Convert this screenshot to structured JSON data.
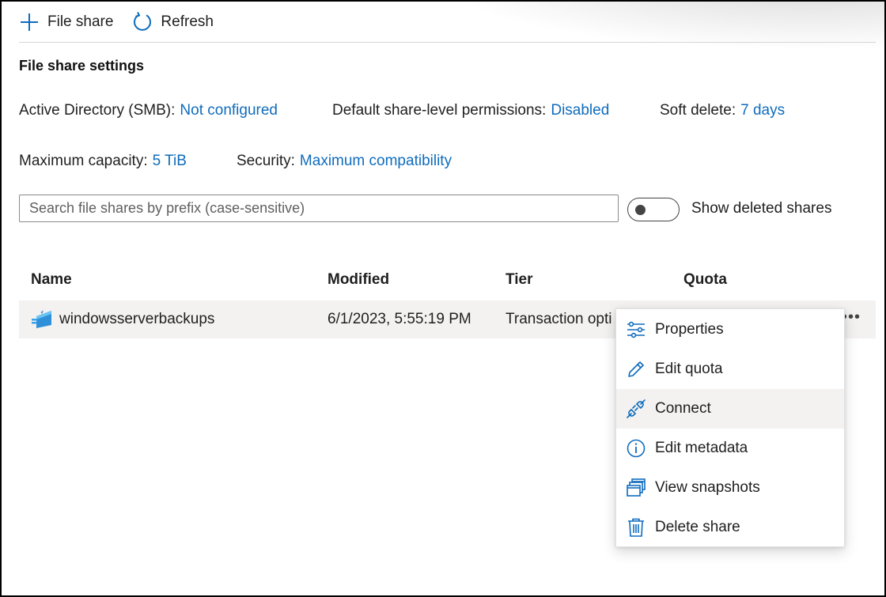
{
  "toolbar": {
    "add_label": "File share",
    "refresh_label": "Refresh"
  },
  "settings": {
    "title": "File share settings",
    "active_directory": {
      "label": "Active Directory (SMB):",
      "value": "Not configured"
    },
    "default_permissions": {
      "label": "Default share-level permissions:",
      "value": "Disabled"
    },
    "soft_delete": {
      "label": "Soft delete:",
      "value": "7 days"
    },
    "max_capacity": {
      "label": "Maximum capacity:",
      "value": "5 TiB"
    },
    "security": {
      "label": "Security:",
      "value": "Maximum compatibility"
    }
  },
  "search": {
    "placeholder": "Search file shares by prefix (case-sensitive)",
    "value": ""
  },
  "show_deleted": {
    "label": "Show deleted shares",
    "on": false
  },
  "table": {
    "columns": [
      "Name",
      "Modified",
      "Tier",
      "Quota"
    ],
    "rows": [
      {
        "name": "windowsserverbackups",
        "modified": "6/1/2023, 5:55:19 PM",
        "tier": "Transaction opti"
      }
    ],
    "more_label": "•••"
  },
  "context_menu": {
    "items": [
      {
        "label": "Properties",
        "icon": "properties-icon"
      },
      {
        "label": "Edit quota",
        "icon": "pencil-icon"
      },
      {
        "label": "Connect",
        "icon": "plug-icon",
        "highlighted": true
      },
      {
        "label": "Edit metadata",
        "icon": "info-icon"
      },
      {
        "label": "View snapshots",
        "icon": "snapshots-icon"
      },
      {
        "label": "Delete share",
        "icon": "trash-icon"
      }
    ]
  },
  "colors": {
    "accent": "#0f6cbd",
    "row_hover": "#f3f2f1",
    "text": "#1f1f1f"
  }
}
